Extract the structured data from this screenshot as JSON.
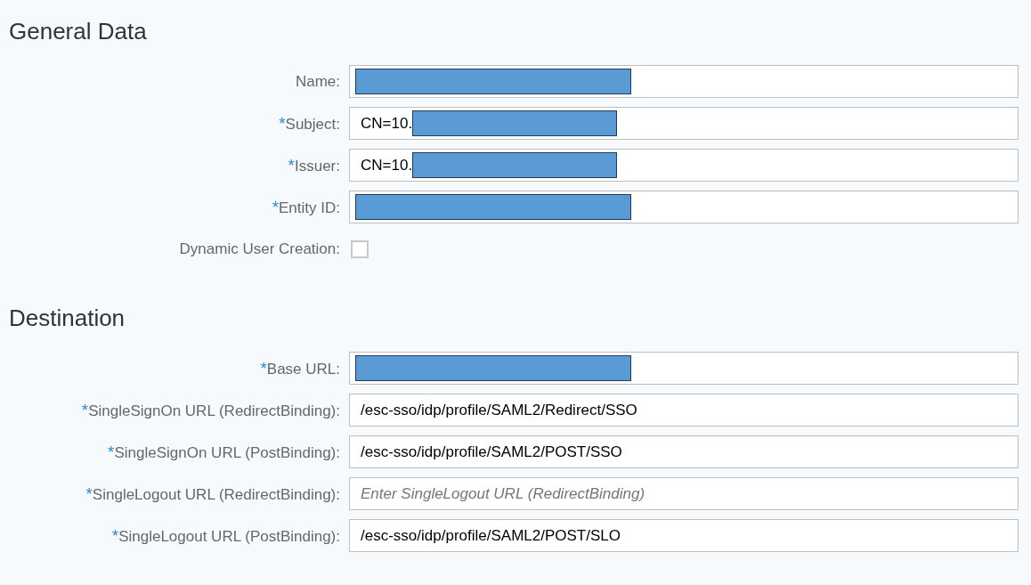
{
  "sections": [
    {
      "title": "General Data",
      "fields": [
        {
          "kind": "text",
          "label": "Name:",
          "redacted": true
        },
        {
          "kind": "text",
          "mark": "*",
          "label": "Subject:",
          "value": "CN=10.",
          "redacted": true
        },
        {
          "kind": "text",
          "mark": "*",
          "label": "Issuer:",
          "value": "CN=10.",
          "redacted": true
        },
        {
          "kind": "text",
          "mark": "*",
          "label": "Entity ID:",
          "redacted": true
        },
        {
          "kind": "checkbox",
          "label": "Dynamic User Creation:",
          "checked": false
        }
      ]
    },
    {
      "title": "Destination",
      "fields": [
        {
          "kind": "text",
          "mark": "*",
          "label": "Base URL:",
          "redacted": true
        },
        {
          "kind": "text",
          "mark": "*",
          "label": "SingleSignOn URL (RedirectBinding):",
          "value": "/esc-sso/idp/profile/SAML2/Redirect/SSO"
        },
        {
          "kind": "text",
          "mark": "*",
          "label": "SingleSignOn URL (PostBinding):",
          "value": "/esc-sso/idp/profile/SAML2/POST/SSO"
        },
        {
          "kind": "text",
          "mark": "*",
          "label": "SingleLogout URL (RedirectBinding):",
          "placeholder": "Enter SingleLogout URL (RedirectBinding)"
        },
        {
          "kind": "text",
          "mark": "*",
          "label": "SingleLogout URL (PostBinding):",
          "value": "/esc-sso/idp/profile/SAML2/POST/SLO"
        }
      ]
    }
  ]
}
